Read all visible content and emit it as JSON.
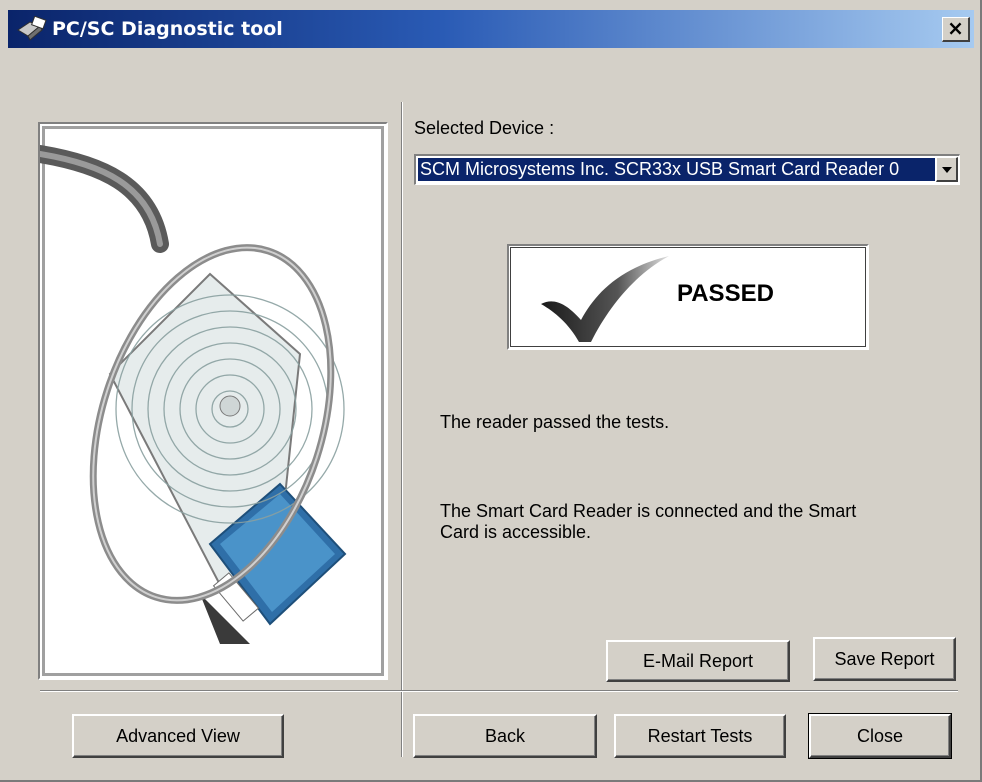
{
  "window": {
    "title": "PC/SC Diagnostic tool",
    "close_glyph": "×"
  },
  "device": {
    "label": "Selected Device :",
    "selected": "SCM Microsystems Inc. SCR33x USB Smart Card Reader 0"
  },
  "result": {
    "status": "PASSED",
    "message": "The reader passed the tests.",
    "detail_line1": "The Smart Card Reader is connected and the Smart",
    "detail_line2": "Card is accessible."
  },
  "buttons": {
    "email_report": "E-Mail Report",
    "save_report": "Save Report",
    "advanced_view": "Advanced View",
    "back": "Back",
    "restart_tests": "Restart Tests",
    "close": "Close"
  },
  "colors": {
    "titlebar_start": "#0a246a",
    "titlebar_end": "#a6caf0",
    "selection": "#0a246a",
    "face": "#d4d0c8"
  }
}
